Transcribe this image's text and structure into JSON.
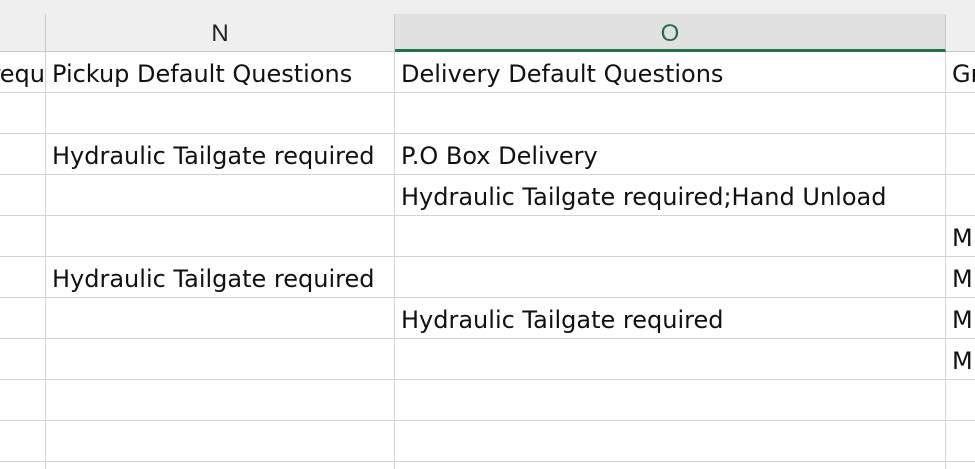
{
  "columns": [
    {
      "letter": "N",
      "selected": false
    },
    {
      "letter": "O",
      "selected": true
    }
  ],
  "header_row": {
    "partial_left": "requ",
    "pickup": "Pickup Default Questions",
    "delivery": "Delivery Default Questions",
    "partial_right": "Gr"
  },
  "rows": [
    {
      "pickup": "",
      "delivery": "",
      "next": ""
    },
    {
      "pickup": "Hydraulic Tailgate required",
      "delivery": "P.O Box Delivery",
      "next": ""
    },
    {
      "pickup": "",
      "delivery": "Hydraulic Tailgate required;Hand Unload",
      "next": ""
    },
    {
      "pickup": "",
      "delivery": "",
      "next": "M"
    },
    {
      "pickup": "Hydraulic Tailgate required",
      "delivery": "",
      "next": "M"
    },
    {
      "pickup": "",
      "delivery": "Hydraulic Tailgate required",
      "next": "M"
    },
    {
      "pickup": "",
      "delivery": "",
      "next": "M"
    },
    {
      "pickup": "",
      "delivery": "",
      "next": ""
    },
    {
      "pickup": "",
      "delivery": "",
      "next": ""
    }
  ],
  "colors": {
    "selected_column_accent": "#217346",
    "header_background": "#efefef",
    "gridline": "#d4d4d4"
  }
}
